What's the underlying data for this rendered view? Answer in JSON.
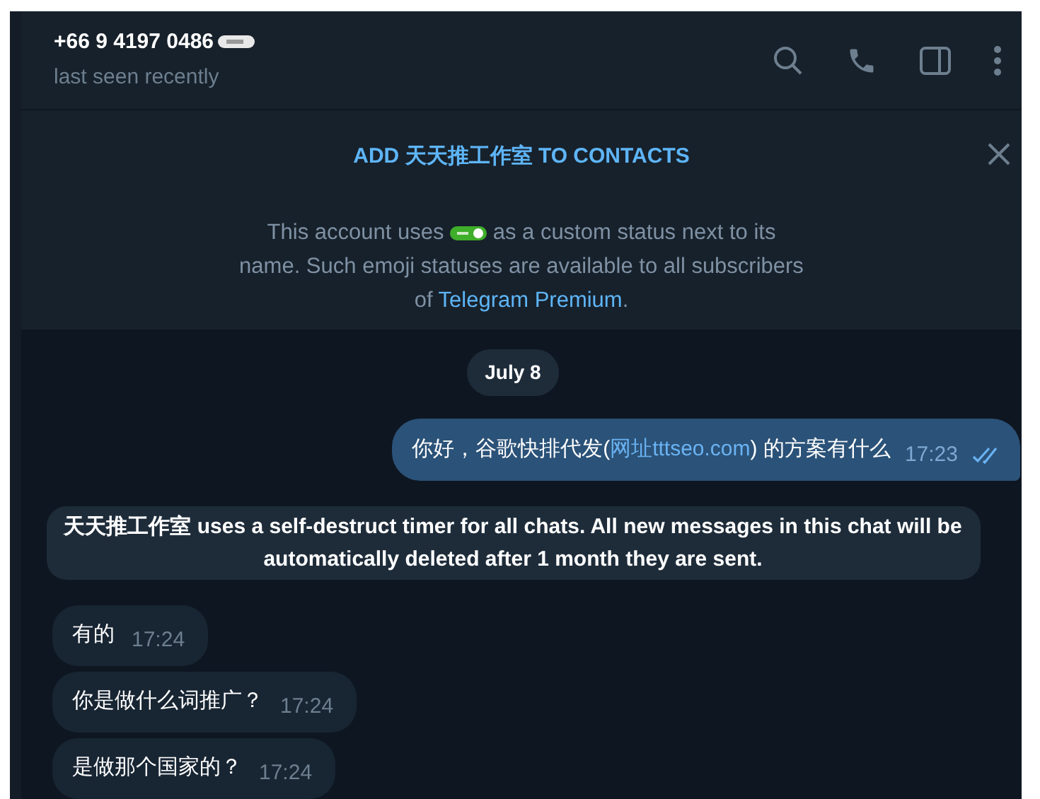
{
  "header": {
    "title": "+66 9 4197 0486",
    "status": "last seen recently"
  },
  "banner": {
    "action": "ADD 天天推工作室 TO CONTACTS",
    "text_before": "This account uses",
    "text_after": "as a custom status next to its name. Such emoji statuses are available to all subscribers of",
    "link": "Telegram Premium",
    "end": "."
  },
  "date": "July 8",
  "messages": [
    {
      "kind": "outgoing",
      "parts": [
        {
          "text": "你好，谷歌快排代发(",
          "link": false
        },
        {
          "text": "网址tttseo.com",
          "link": true
        },
        {
          "text": ") 的方案有什么",
          "link": false
        }
      ],
      "time": "17:23",
      "read": true
    },
    {
      "kind": "service",
      "text": "天天推工作室 uses a self-destruct timer for all chats. All new messages in this chat will be automatically deleted after 1 month they are sent."
    },
    {
      "kind": "incoming",
      "parts": [
        {
          "text": "有的",
          "link": false
        }
      ],
      "time": "17:24"
    },
    {
      "kind": "incoming",
      "parts": [
        {
          "text": "你是做什么词推广？",
          "link": false
        }
      ],
      "time": "17:24"
    },
    {
      "kind": "incoming",
      "parts": [
        {
          "text": "是做那个国家的？",
          "link": false
        }
      ],
      "time": "17:24"
    }
  ]
}
